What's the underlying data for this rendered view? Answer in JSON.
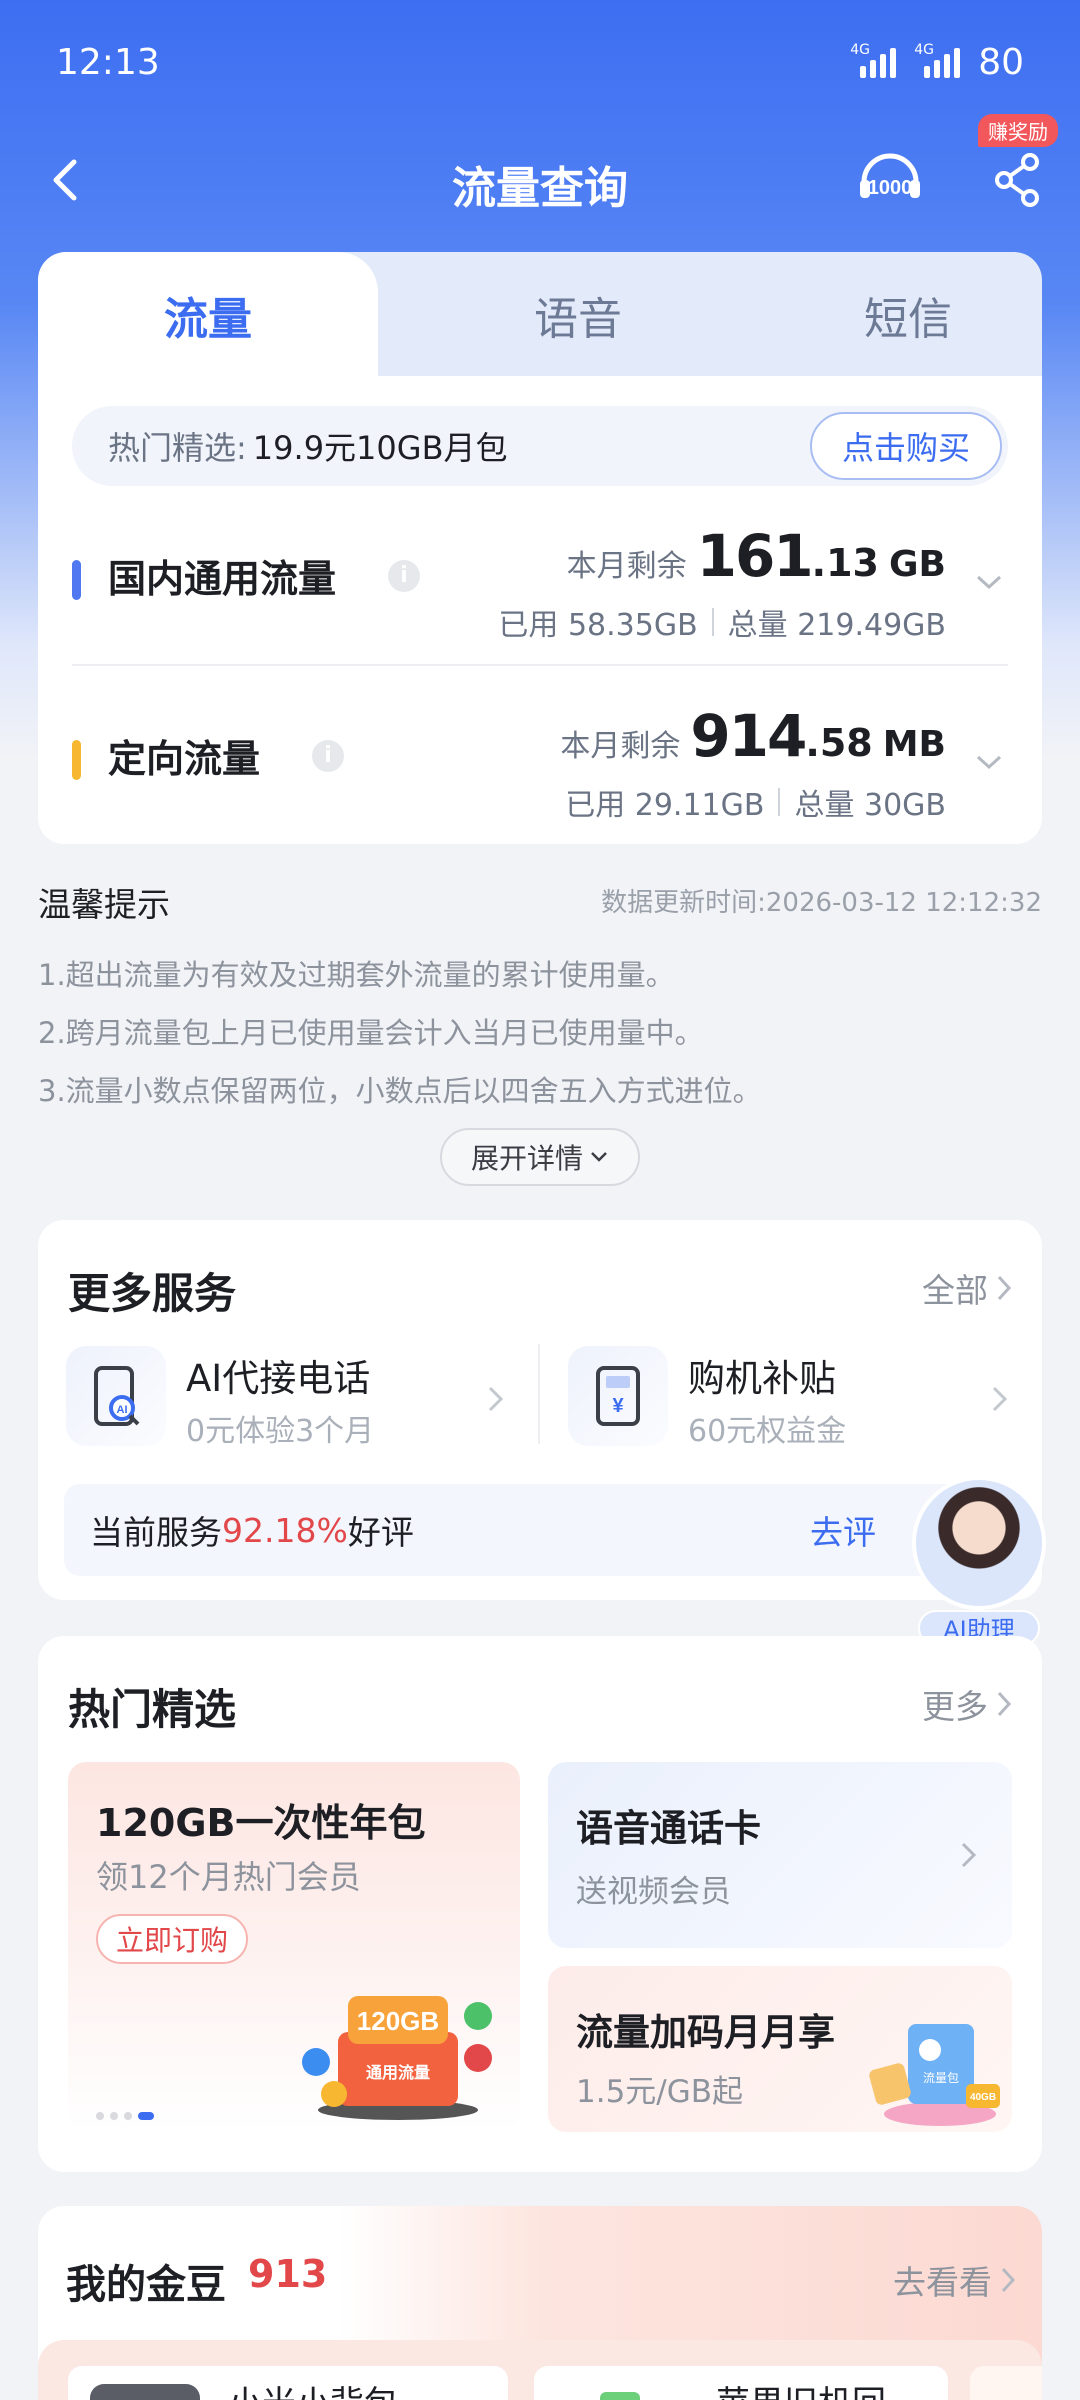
{
  "status_bar": {
    "time": "12:13",
    "network1": "4G",
    "network2": "4G",
    "battery": "80"
  },
  "navbar": {
    "title": "流量查询",
    "reward_badge": "赚奖励",
    "service_icon": "10000-icon",
    "share_icon": "share-icon",
    "back_icon": "back-icon"
  },
  "tabs": [
    {
      "label": "流量",
      "active": true
    },
    {
      "label": "语音",
      "active": false
    },
    {
      "label": "短信",
      "active": false
    }
  ],
  "promo": {
    "key": "热门精选:",
    "value": "19.9元10GB月包",
    "button": "点击购买"
  },
  "rows": [
    {
      "name": "国内通用流量",
      "color": "#4f78f1",
      "remain_label": "本月剩余",
      "remain_int": "161",
      "remain_dec": ".13",
      "unit": "GB",
      "used": "已用 58.35GB",
      "total": "总量 219.49GB"
    },
    {
      "name": "定向流量",
      "color": "#f7b731",
      "remain_label": "本月剩余",
      "remain_int": "914",
      "remain_dec": ".58",
      "unit": "MB",
      "used": "已用 29.11GB",
      "total": "总量 30GB"
    }
  ],
  "tips": {
    "title": "温馨提示",
    "updated": "数据更新时间:2026-03-12 12:12:32",
    "items": [
      "1.超出流量为有效及过期套外流量的累计使用量。",
      "2.跨月流量包上月已使用量会计入当月已使用量中。",
      "3.流量小数点保留两位，小数点后以四舍五入方式进位。"
    ],
    "expand": "展开详情"
  },
  "services": {
    "title": "更多服务",
    "more": "全部",
    "items": [
      {
        "title": "AI代接电话",
        "sub": "0元体验3个月"
      },
      {
        "title": "购机补贴",
        "sub": "60元权益金"
      }
    ],
    "rating_prefix": "当前服务",
    "rating_pct": "92.18%",
    "rating_suffix": "好评",
    "rating_go": "去评",
    "assistant": "AI助理"
  },
  "hot": {
    "title": "热门精选",
    "more": "更多",
    "left": {
      "title": "120GB一次性年包",
      "sub": "领12个月热门会员",
      "button": "立即订购",
      "badge": "120GB",
      "ribbon": "通用流量"
    },
    "right_top": {
      "title": "语音通话卡",
      "sub": "送视频会员"
    },
    "right_bottom": {
      "title": "流量加码月月享",
      "sub": "1.5元/GB起",
      "tag": "流量包",
      "tag2": "40GB"
    }
  },
  "beans": {
    "title": "我的金豆",
    "count": "913",
    "more": "去看看",
    "items": [
      "小米小背包",
      "苹果旧机回"
    ]
  }
}
